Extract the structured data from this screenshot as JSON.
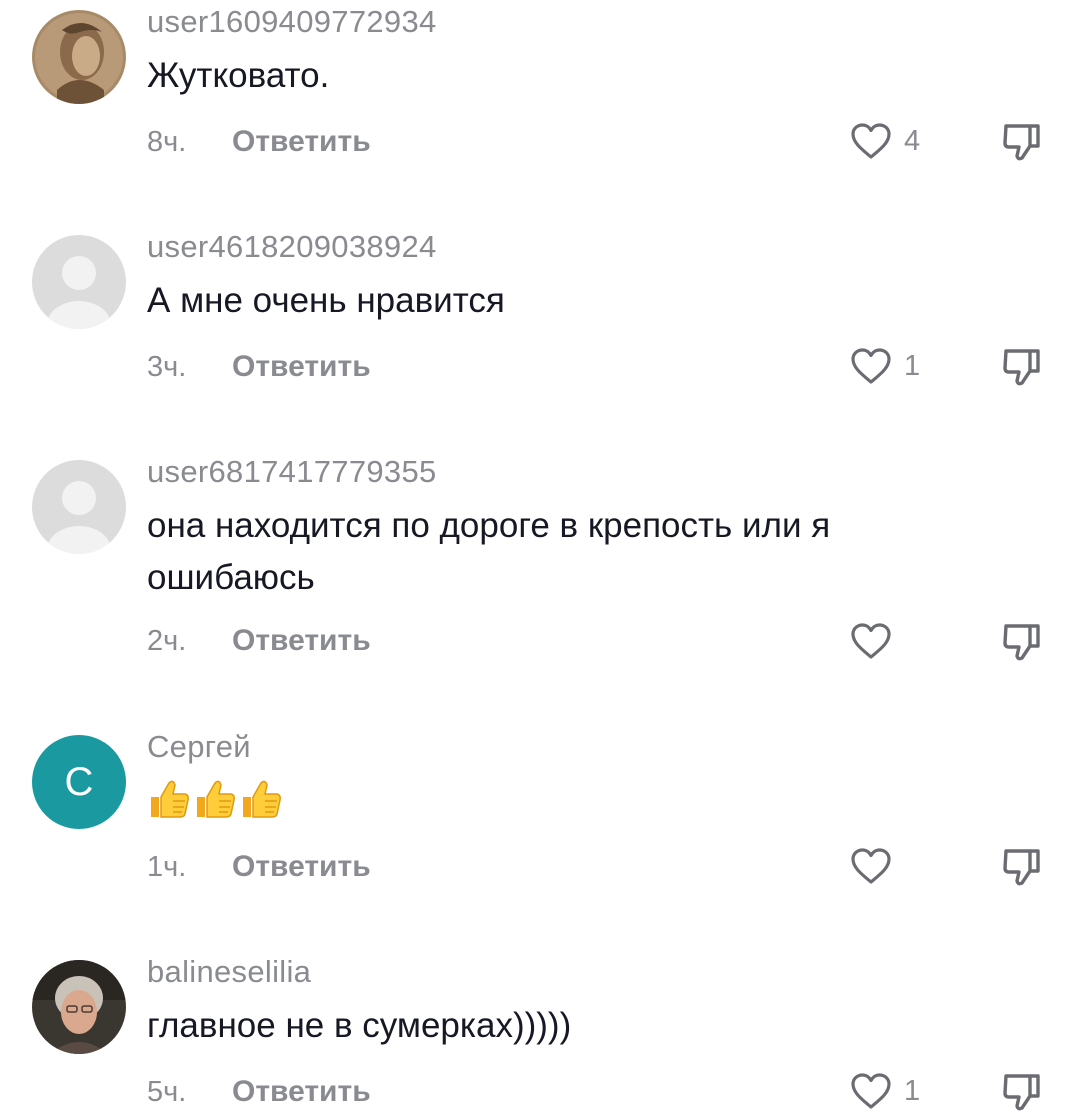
{
  "comments": [
    {
      "username": "user1609409772934",
      "text": "Жутковато.",
      "time": "8ч.",
      "reply_label": "Ответить",
      "likes": "4",
      "avatar": "photo-portrait-sepia"
    },
    {
      "username": "user4618209038924",
      "text": "А мне очень нравится",
      "time": "3ч.",
      "reply_label": "Ответить",
      "likes": "1",
      "avatar": "default-user-icon"
    },
    {
      "username": "user6817417779355",
      "text": "она находится по дороге в крепость или я ошибаюсь",
      "time": "2ч.",
      "reply_label": "Ответить",
      "likes": "",
      "avatar": "default-user-icon"
    },
    {
      "username": "Сергей",
      "text": "",
      "emojis": [
        "thumbs-up-emoji",
        "thumbs-up-emoji",
        "thumbs-up-emoji"
      ],
      "time": "1ч.",
      "reply_label": "Ответить",
      "likes": "",
      "avatar_letter": "С",
      "avatar_color": "#1a9aa0"
    },
    {
      "username": "balineselilia",
      "text": "главное не в сумерках)))))",
      "time": "5ч.",
      "reply_label": "Ответить",
      "likes": "1",
      "avatar": "photo-portrait-woman"
    }
  ],
  "colors": {
    "text": "#161823",
    "secondary": "#8a8b91",
    "icon": "#6b6c72"
  }
}
